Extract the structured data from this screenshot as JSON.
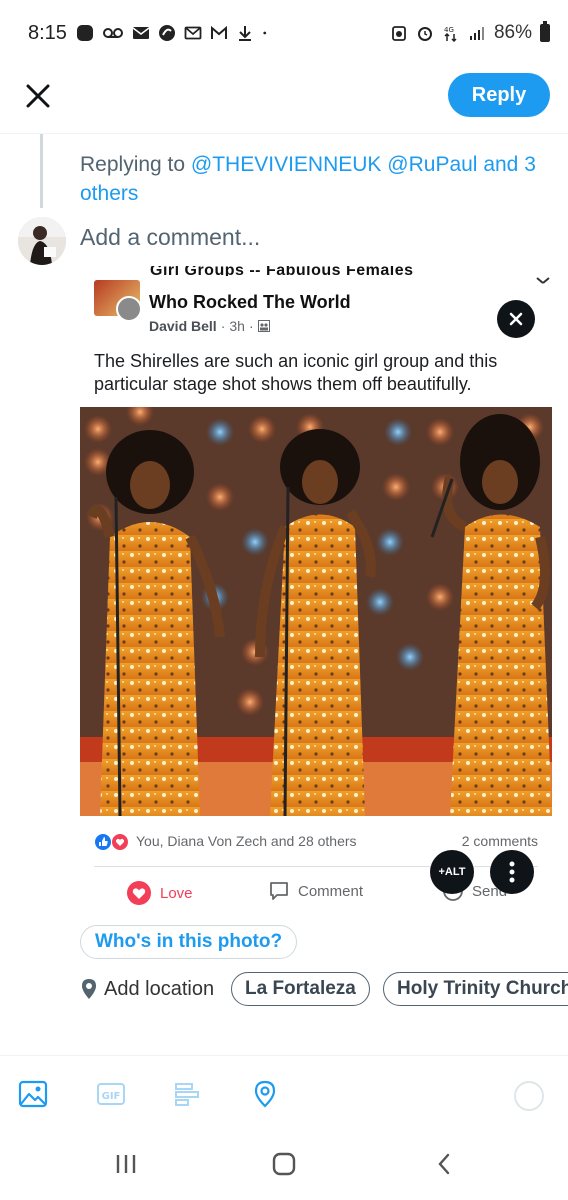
{
  "status_bar": {
    "time": "8:15",
    "battery": "86%",
    "network": "4G"
  },
  "header": {
    "reply_label": "Reply"
  },
  "replying": {
    "prefix": "Replying to",
    "mention1": "@THEVIVIENNEUK",
    "mention2": "@RuPaul",
    "suffix": "and 3 others"
  },
  "composer": {
    "placeholder": "Add a comment..."
  },
  "attachment": {
    "group_name_cut": "Girl Groups -- Fabulous Females",
    "group_name": "Who Rocked The World",
    "author": "David Bell",
    "time": "3h",
    "text": "The Shirelles are such an iconic girl group and this particular stage shot shows them off beautifully.",
    "reactions_text": "You, Diana Von Zech and 28 others",
    "comments_count": "2 comments",
    "action_love": "Love",
    "action_comment": "Comment",
    "action_send": "Send",
    "alt_label": "+ALT"
  },
  "tag_people": "Who's in this photo?",
  "location": {
    "label": "Add location",
    "suggestions": [
      "La Fortaleza",
      "Holy Trinity Church"
    ]
  },
  "colors": {
    "accent": "#1d9bf0",
    "text_secondary": "#536471",
    "dark_button": "#0f1419"
  },
  "icons": {
    "close": "close-icon",
    "media": "image-icon",
    "gif": "gif-icon",
    "poll": "poll-icon",
    "location": "location-pin-icon"
  }
}
